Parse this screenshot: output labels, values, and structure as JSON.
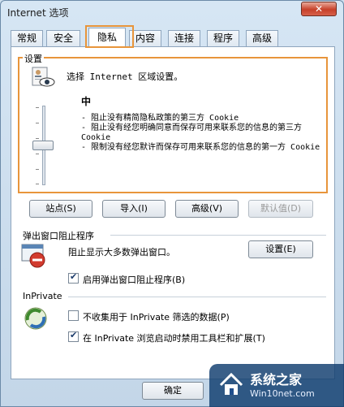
{
  "window": {
    "title": "Internet 选项",
    "close_label": "✕"
  },
  "tabs": [
    {
      "label": "常规"
    },
    {
      "label": "安全"
    },
    {
      "label": "隐私"
    },
    {
      "label": "内容"
    },
    {
      "label": "连接"
    },
    {
      "label": "程序"
    },
    {
      "label": "高级"
    }
  ],
  "settings": {
    "group_title": "设置",
    "prompt": "选择 Internet 区域设置。",
    "level": "中",
    "descriptions": [
      "- 阻止没有精简隐私政策的第三方 Cookie",
      "- 阻止没有经您明确同意而保存可用来联系您的信息的第三方 Cookie",
      "- 限制没有经您默许而保存可用来联系您的信息的第一方 Cookie"
    ]
  },
  "buttons": {
    "sites": "站点(S)",
    "import": "导入(I)",
    "advanced": "高级(V)",
    "default": "默认值(D)"
  },
  "popup_blocker": {
    "section_label": "弹出窗口阻止程序",
    "description": "阻止显示大多数弹出窗口。",
    "settings_button": "设置(E)",
    "enable_label": "启用弹出窗口阻止程序(B)",
    "enable_checked": true
  },
  "inprivate": {
    "section_label": "InPrivate",
    "no_collect_label": "不收集用于 InPrivate 筛选的数据(P)",
    "no_collect_checked": false,
    "disable_toolbars_label": "在 InPrivate 浏览启动时禁用工具栏和扩展(T)",
    "disable_toolbars_checked": true
  },
  "footer": {
    "ok_label": "确定"
  },
  "watermark": {
    "title": "系统之家",
    "subtitle": "Win10net.com"
  },
  "colors": {
    "highlight": "#e8953b",
    "accent": "#1f4e8c"
  }
}
